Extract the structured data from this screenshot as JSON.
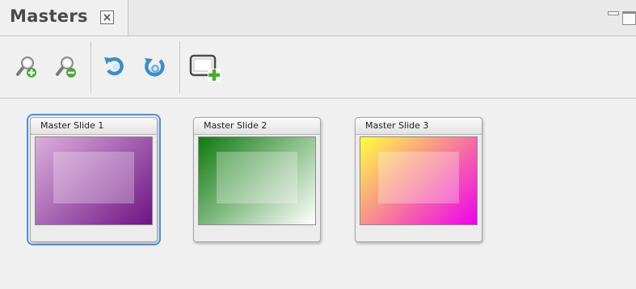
{
  "panel": {
    "tab_label": "Masters",
    "tab_close_icon": "close-icon",
    "minimize_icon": "minimize-icon",
    "maximize_icon": "maximize-icon"
  },
  "toolbar": {
    "buttons": [
      {
        "icon": "zoom-in-icon"
      },
      {
        "icon": "zoom-out-icon"
      },
      {
        "icon": "rotate-left-icon"
      },
      {
        "icon": "rotate-right-icon"
      },
      {
        "icon": "new-master-slide-icon"
      }
    ]
  },
  "slides": [
    {
      "title": "Master Slide 1",
      "selected": true,
      "gradient": [
        "#dcaedc",
        "#6e1484"
      ]
    },
    {
      "title": "Master Slide 2",
      "selected": false,
      "gradient": [
        "#0f7a0f",
        "#ffffff"
      ]
    },
    {
      "title": "Master Slide 3",
      "selected": false,
      "gradient": [
        "#ffff40",
        "#ee00ee"
      ]
    }
  ],
  "colors": {
    "selection": "#4f8fd6",
    "background": "#f0f0f0"
  }
}
